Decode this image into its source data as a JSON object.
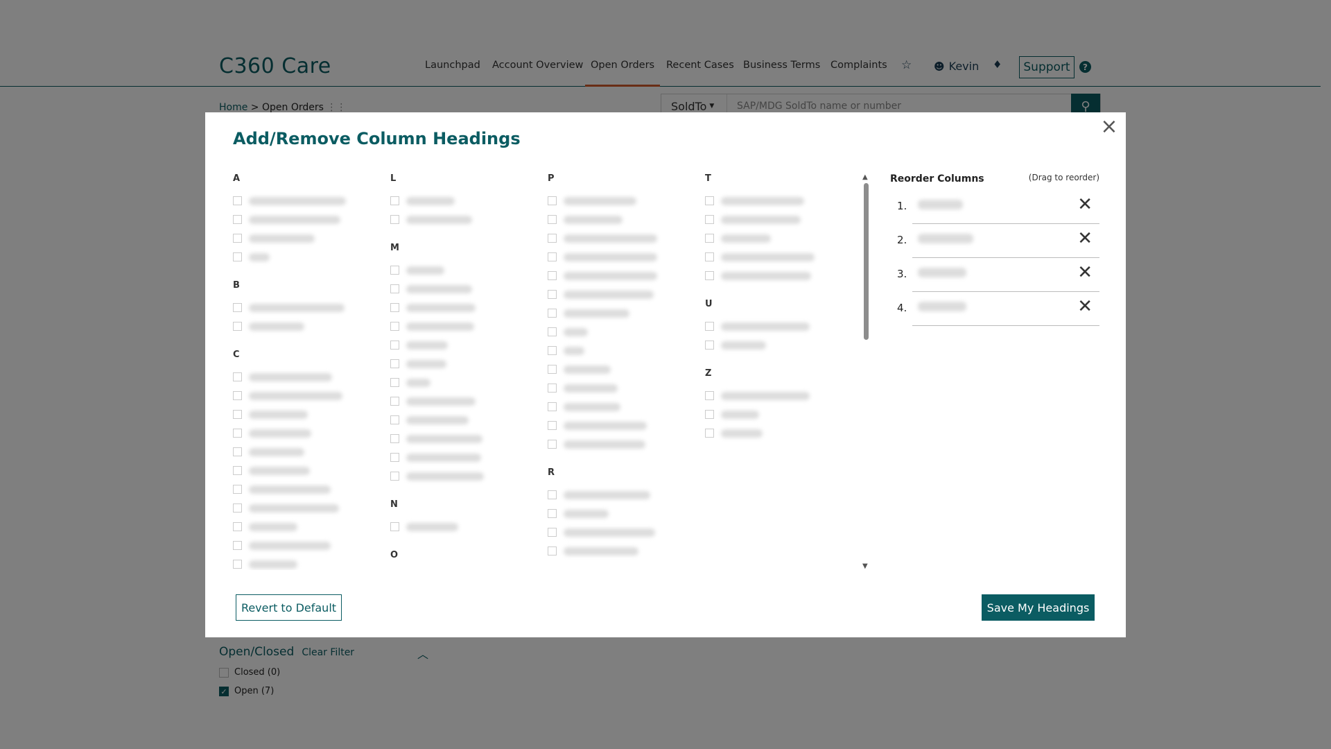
{
  "brand": "C360 Care",
  "nav": [
    {
      "label": "Launchpad",
      "active": false
    },
    {
      "label": "Account Overview",
      "active": false
    },
    {
      "label": "Open Orders",
      "active": true
    },
    {
      "label": "Recent Cases",
      "active": false
    },
    {
      "label": "Business Terms",
      "active": false
    },
    {
      "label": "Complaints",
      "active": false
    }
  ],
  "user": {
    "name": "Kevin"
  },
  "support_label": "Support",
  "help_label": "?",
  "breadcrumb": {
    "home": "Home",
    "separator": " > ",
    "current": "Open Orders"
  },
  "search": {
    "scope": "SoldTo",
    "placeholder": "SAP/MDG SoldTo name or number"
  },
  "filter": {
    "title": "Open/Closed",
    "clear": "Clear Filter",
    "options": [
      {
        "label": "Closed (0)",
        "checked": false
      },
      {
        "label": "Open (7)",
        "checked": true
      }
    ]
  },
  "modal": {
    "title": "Add/Remove Column Headings",
    "letters": [
      "A",
      "B",
      "C",
      "L",
      "M",
      "N",
      "O",
      "P",
      "R",
      "T",
      "U",
      "Z"
    ],
    "reorder_title": "Reorder Columns",
    "reorder_hint": "(Drag to reorder)",
    "reorder_items": [
      {
        "num": "1."
      },
      {
        "num": "2."
      },
      {
        "num": "3."
      },
      {
        "num": "4."
      }
    ],
    "revert_label": "Revert to Default",
    "save_label": "Save My Headings"
  },
  "colors": {
    "brand": "#0b5c62",
    "accent": "#d35b2b"
  }
}
